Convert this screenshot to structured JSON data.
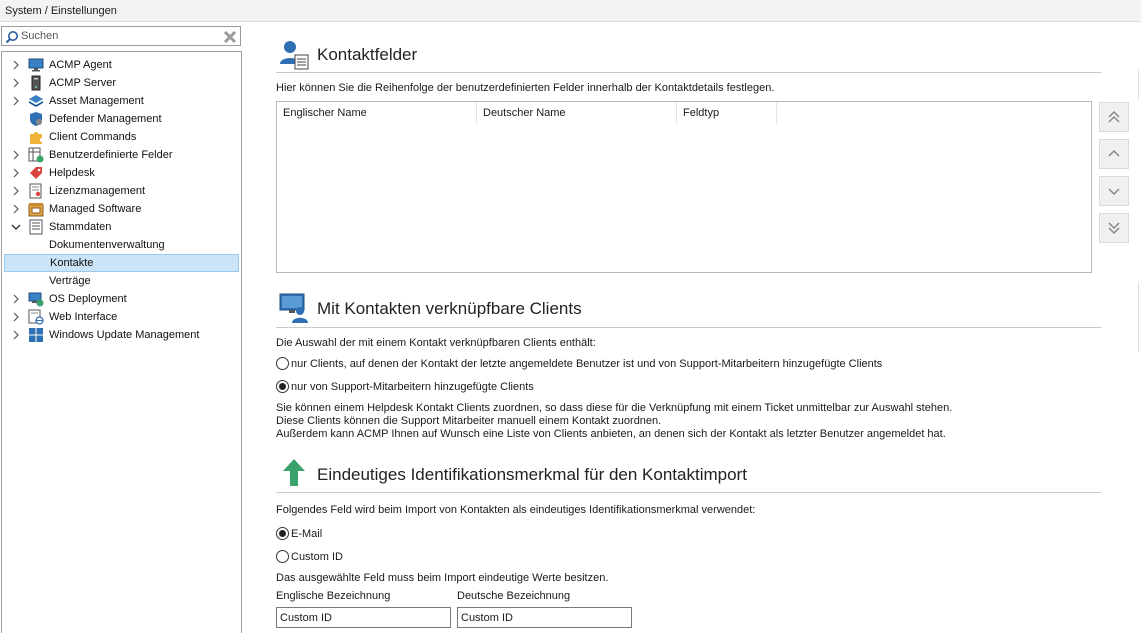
{
  "breadcrumb": "System / Einstellungen",
  "search": {
    "placeholder": "Suchen"
  },
  "tree": [
    {
      "label": "ACMP Agent",
      "icon": "monitor-icon",
      "expandable": true
    },
    {
      "label": "ACMP Server",
      "icon": "server-icon",
      "expandable": true
    },
    {
      "label": "Asset Management",
      "icon": "asset-stack-icon",
      "expandable": true
    },
    {
      "label": "Defender Management",
      "icon": "shield-icon",
      "expandable": false
    },
    {
      "label": "Client Commands",
      "icon": "puzzle-icon",
      "expandable": false
    },
    {
      "label": "Benutzerdefinierte Felder",
      "icon": "custom-fields-icon",
      "expandable": true
    },
    {
      "label": "Helpdesk",
      "icon": "tag-icon",
      "expandable": true
    },
    {
      "label": "Lizenzmanagement",
      "icon": "license-icon",
      "expandable": true
    },
    {
      "label": "Managed Software",
      "icon": "software-box-icon",
      "expandable": true
    },
    {
      "label": "Stammdaten",
      "icon": "master-data-icon",
      "expandable": true,
      "expanded": true
    },
    {
      "label": "Dokumentenverwaltung",
      "child": true
    },
    {
      "label": "Kontakte",
      "child": true,
      "selected": true
    },
    {
      "label": "Verträge",
      "child": true
    },
    {
      "label": "OS Deployment",
      "icon": "os-deploy-icon",
      "expandable": true
    },
    {
      "label": "Web Interface",
      "icon": "web-interface-icon",
      "expandable": true
    },
    {
      "label": "Windows Update Management",
      "icon": "windows-icon",
      "expandable": true
    }
  ],
  "kontaktfelder": {
    "title": "Kontaktfelder",
    "description": "Hier können Sie die Reihenfolge der benutzerdefinierten Felder innerhalb der Kontaktdetails festlegen.",
    "columns": [
      "Englischer Name",
      "Deutscher Name",
      "Feldtyp"
    ]
  },
  "clients": {
    "title": "Mit Kontakten verknüpfbare Clients",
    "intro": "Die Auswahl der mit einem Kontakt verknüpfbaren Clients enthält:",
    "option1": "nur Clients, auf denen der Kontakt der letzte angemeldete Benutzer ist und von Support-Mitarbeitern hinzugefügte Clients",
    "option2": "nur von Support-Mitarbeitern hinzugefügte Clients",
    "selected_option": 2,
    "info1": "Sie können einem Helpdesk Kontakt Clients zuordnen, so dass diese für die Verknüpfung mit einem Ticket unmittelbar zur Auswahl stehen.",
    "info2": "Diese Clients können die Support Mitarbeiter manuell einem Kontakt zuordnen.",
    "info3": "Außerdem kann ACMP Ihnen auf Wunsch eine Liste von Clients anbieten, an denen sich der Kontakt als letzter Benutzer angemeldet hat."
  },
  "identifier": {
    "title": "Eindeutiges Identifikationsmerkmal für den Kontaktimport",
    "intro": "Folgendes Feld wird beim Import von Kontakten als eindeutiges Identifikationsmerkmal verwendet:",
    "option_email": "E-Mail",
    "option_custom": "Custom ID",
    "selected_option": "email",
    "note": "Das ausgewählte Feld muss beim Import eindeutige Werte besitzen.",
    "english_label": "Englische Bezeichnung",
    "german_label": "Deutsche Bezeichnung",
    "english_value": "Custom ID",
    "german_value": "Custom ID"
  },
  "colors": {
    "accent": "#2f6fb3",
    "green_arrow": "#3aa36b",
    "selection": "#cce4f7"
  }
}
